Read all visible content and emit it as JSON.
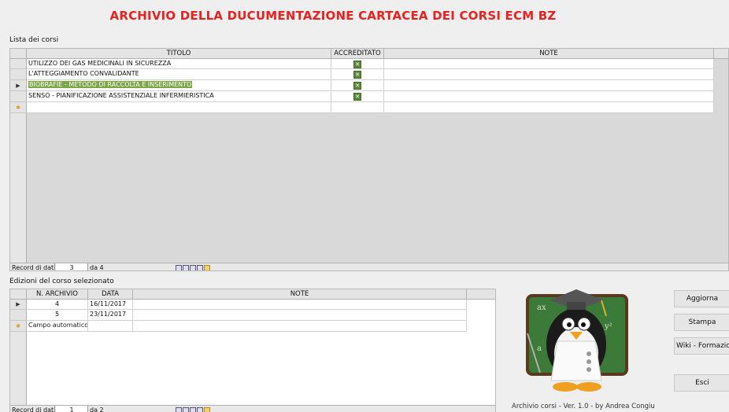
{
  "title": "ARCHIVIO DELLA DUCUMENTAZIONE CARTACEA DEI CORSI ECM BZ",
  "courses": {
    "label": "Lista dei corsi",
    "columns": [
      "TITOLO",
      "ACCREDITATO",
      "NOTE"
    ],
    "rows": [
      {
        "titolo": "UTILIZZO DEI GAS MEDICINALI IN SICUREZZA",
        "accreditato": true,
        "note": ""
      },
      {
        "titolo": "L'ATTEGGIAMENTO CONVALIDANTE",
        "accreditato": true,
        "note": ""
      },
      {
        "titolo": "BIOBRAFIE - METODO DI RACCOLTA E INSERIMENTO",
        "accreditato": true,
        "note": ""
      },
      {
        "titolo": "SENSO - PIANIFICAZIONE ASSISTENZIALE INFERMIERISTICA",
        "accreditato": true,
        "note": ""
      }
    ],
    "selected_row": 3,
    "nav": {
      "label": "Record di dati",
      "current": "3",
      "total": "da 4"
    }
  },
  "editions": {
    "label": "Edizioni del corso selezionato",
    "columns": [
      "N. ARCHIVIO",
      "DATA",
      "NOTE"
    ],
    "rows": [
      {
        "archivio": "4",
        "data": "16/11/2017",
        "note": ""
      },
      {
        "archivio": "5",
        "data": "23/11/2017",
        "note": ""
      }
    ],
    "new_row_placeholder": "Campo automatico",
    "nav": {
      "label": "Record di dati",
      "current": "1",
      "total": "da 2"
    }
  },
  "buttons": {
    "aggiorna": "Aggiorna",
    "stampa": "Stampa",
    "wiki": "Wiki - Formazione",
    "esci": "Esci"
  },
  "footer": "Archivio corsi - Ver. 1.0 - by Andrea Congiu",
  "icons": {
    "row_pointer": "row-pointer-icon",
    "new_row": "new-row-star-icon",
    "check": "checkbox-checked-icon",
    "logo": "penguin-graduate-logo"
  },
  "colors": {
    "title": "#e8221f",
    "selection": "#7aa646"
  }
}
